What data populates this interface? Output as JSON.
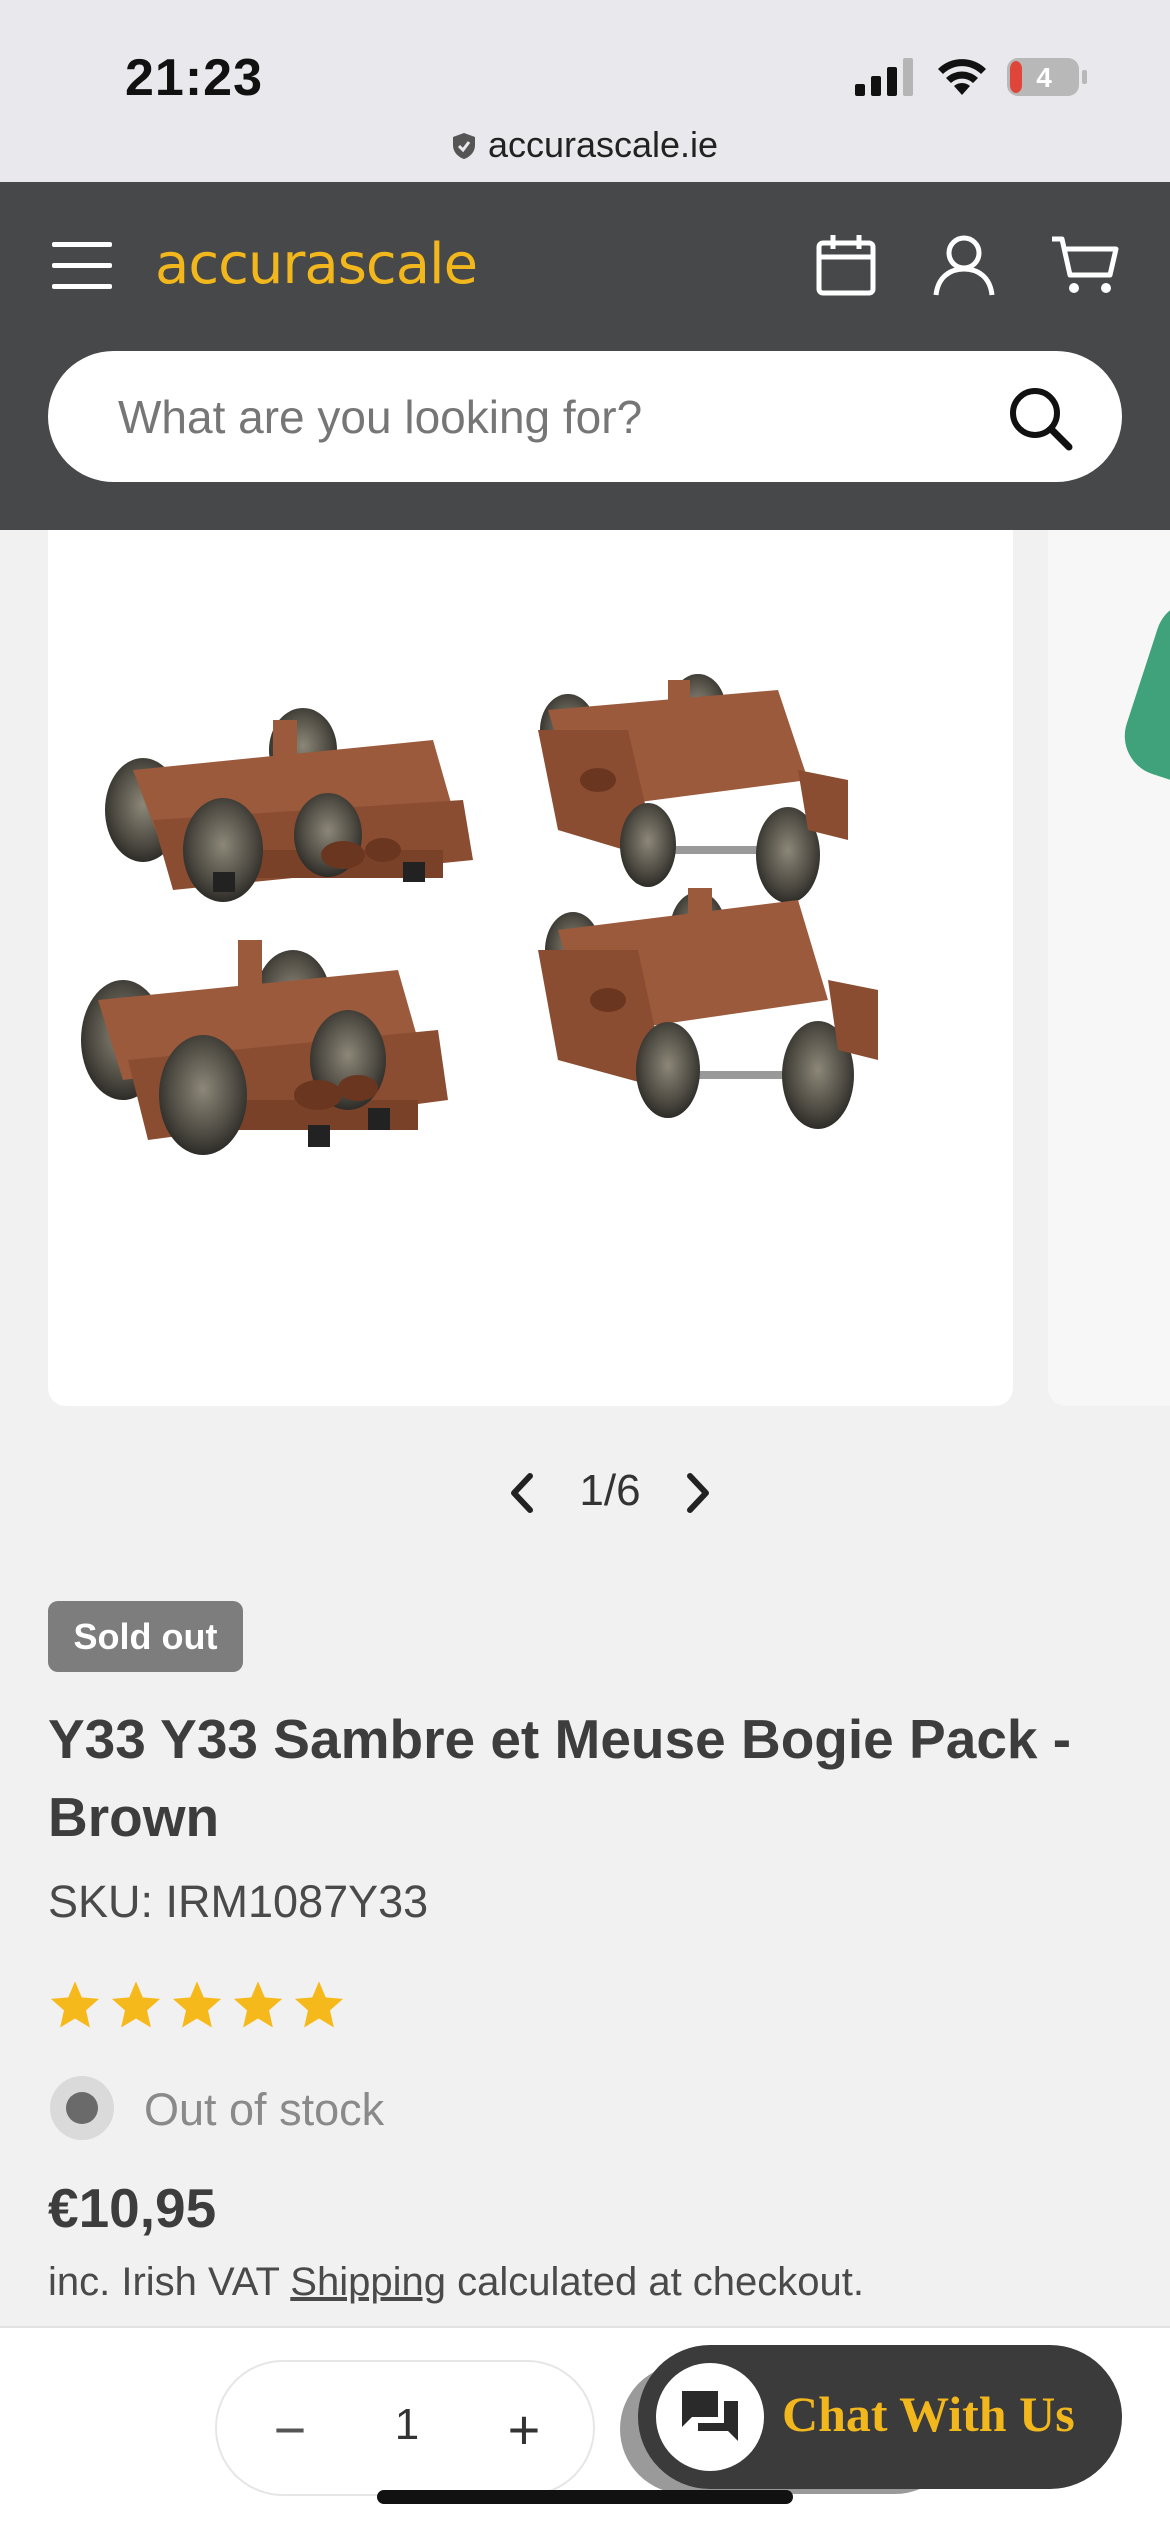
{
  "status_bar": {
    "time": "21:23",
    "battery": "4",
    "url": "accurascale.ie"
  },
  "header": {
    "logo": "accurascale",
    "search_placeholder": "What are you looking for?",
    "brand_color": "#f2b71c",
    "header_bg": "#474849"
  },
  "gallery": {
    "page_indicator": "1/6",
    "image_alt": "Y33 Sambre et Meuse bogies in brown"
  },
  "product": {
    "badge": "Sold out",
    "title": "Y33 Y33 Sambre et Meuse Bogie Pack - Brown",
    "sku": "SKU: IRM1087Y33",
    "rating": 5,
    "rating_max": 5,
    "stock_status": "Out of stock",
    "price": "€10,95",
    "vat_prefix": "inc. Irish VAT ",
    "shipping_link": "Shipping",
    "vat_suffix": " calculated at checkout.",
    "star_color": "#f6b91b"
  },
  "bottom_bar": {
    "qty_minus": "−",
    "qty_value": "1",
    "qty_plus": "+",
    "chat_label": "Chat With Us"
  }
}
